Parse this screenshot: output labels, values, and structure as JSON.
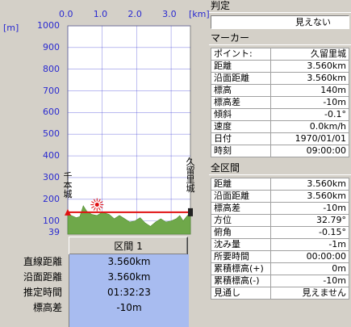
{
  "chart_data": {
    "type": "area",
    "xunit": "[km]",
    "yunit": "[m]",
    "x_ticks": [
      "0.0",
      "1.0",
      "2.0",
      "3.0"
    ],
    "y_ticks": [
      "1000",
      "900",
      "800",
      "700",
      "600",
      "500",
      "400",
      "300",
      "200",
      "100"
    ],
    "y_min_label": "39",
    "xlim": [
      0,
      3.56
    ],
    "ylim": [
      39,
      1000
    ],
    "start_label": "千本城",
    "end_label": "久留里城",
    "terrain": {
      "x": [
        0.0,
        0.1,
        0.25,
        0.35,
        0.45,
        0.55,
        0.7,
        0.85,
        1.0,
        1.2,
        1.35,
        1.5,
        1.65,
        1.8,
        1.95,
        2.1,
        2.25,
        2.4,
        2.55,
        2.7,
        2.85,
        3.0,
        3.15,
        3.25,
        3.35,
        3.45,
        3.56
      ],
      "y": [
        140,
        125,
        115,
        120,
        170,
        145,
        130,
        125,
        140,
        130,
        110,
        125,
        110,
        95,
        100,
        115,
        90,
        75,
        95,
        110,
        95,
        100,
        110,
        125,
        100,
        120,
        140
      ]
    },
    "sight_line": {
      "x": [
        0.0,
        3.56
      ],
      "y": [
        140,
        140
      ]
    },
    "flag_x": 0.85,
    "flag_y": 145
  },
  "interval_button": "区間 1",
  "summary": {
    "labels": [
      "直線距離",
      "沿面距離",
      "推定時間",
      "標高差"
    ],
    "values": [
      "3.560km",
      "3.560km",
      "01:32:23",
      "-10m"
    ]
  },
  "judgement": {
    "title": "判定",
    "value": "見えない"
  },
  "marker": {
    "title": "マーカー",
    "rows": [
      {
        "k": "ポイント:",
        "v": "久留里城"
      },
      {
        "k": "距離",
        "v": "3.560km"
      },
      {
        "k": "沿面距離",
        "v": "3.560km"
      },
      {
        "k": "標高",
        "v": "140m"
      },
      {
        "k": "標高差",
        "v": "-10m"
      },
      {
        "k": "傾斜",
        "v": "-0.1°"
      },
      {
        "k": "速度",
        "v": "0.0km/h"
      },
      {
        "k": "日付",
        "v": "1970/01/01"
      },
      {
        "k": "時刻",
        "v": "09:00:00"
      }
    ]
  },
  "all_section": {
    "title": "全区間",
    "rows": [
      {
        "k": "距離",
        "v": "3.560km"
      },
      {
        "k": "沿面距離",
        "v": "3.560km"
      },
      {
        "k": "標高差",
        "v": "-10m"
      },
      {
        "k": "方位",
        "v": "32.79°"
      },
      {
        "k": "俯角",
        "v": "-0.15°"
      },
      {
        "k": "沈み量",
        "v": "-1m"
      },
      {
        "k": "所要時間",
        "v": "00:00:00"
      },
      {
        "k": "累積標高(+)",
        "v": "0m"
      },
      {
        "k": "累積標高(-)",
        "v": "-10m"
      },
      {
        "k": "見通し",
        "v": "見えません"
      }
    ]
  },
  "colors": {
    "plot_bg": "#ffffff",
    "terrain": "#6fa84a",
    "sight_line": "#e01010",
    "grid": "#4a4ad8",
    "stats_bg": "#a8bcf0"
  }
}
